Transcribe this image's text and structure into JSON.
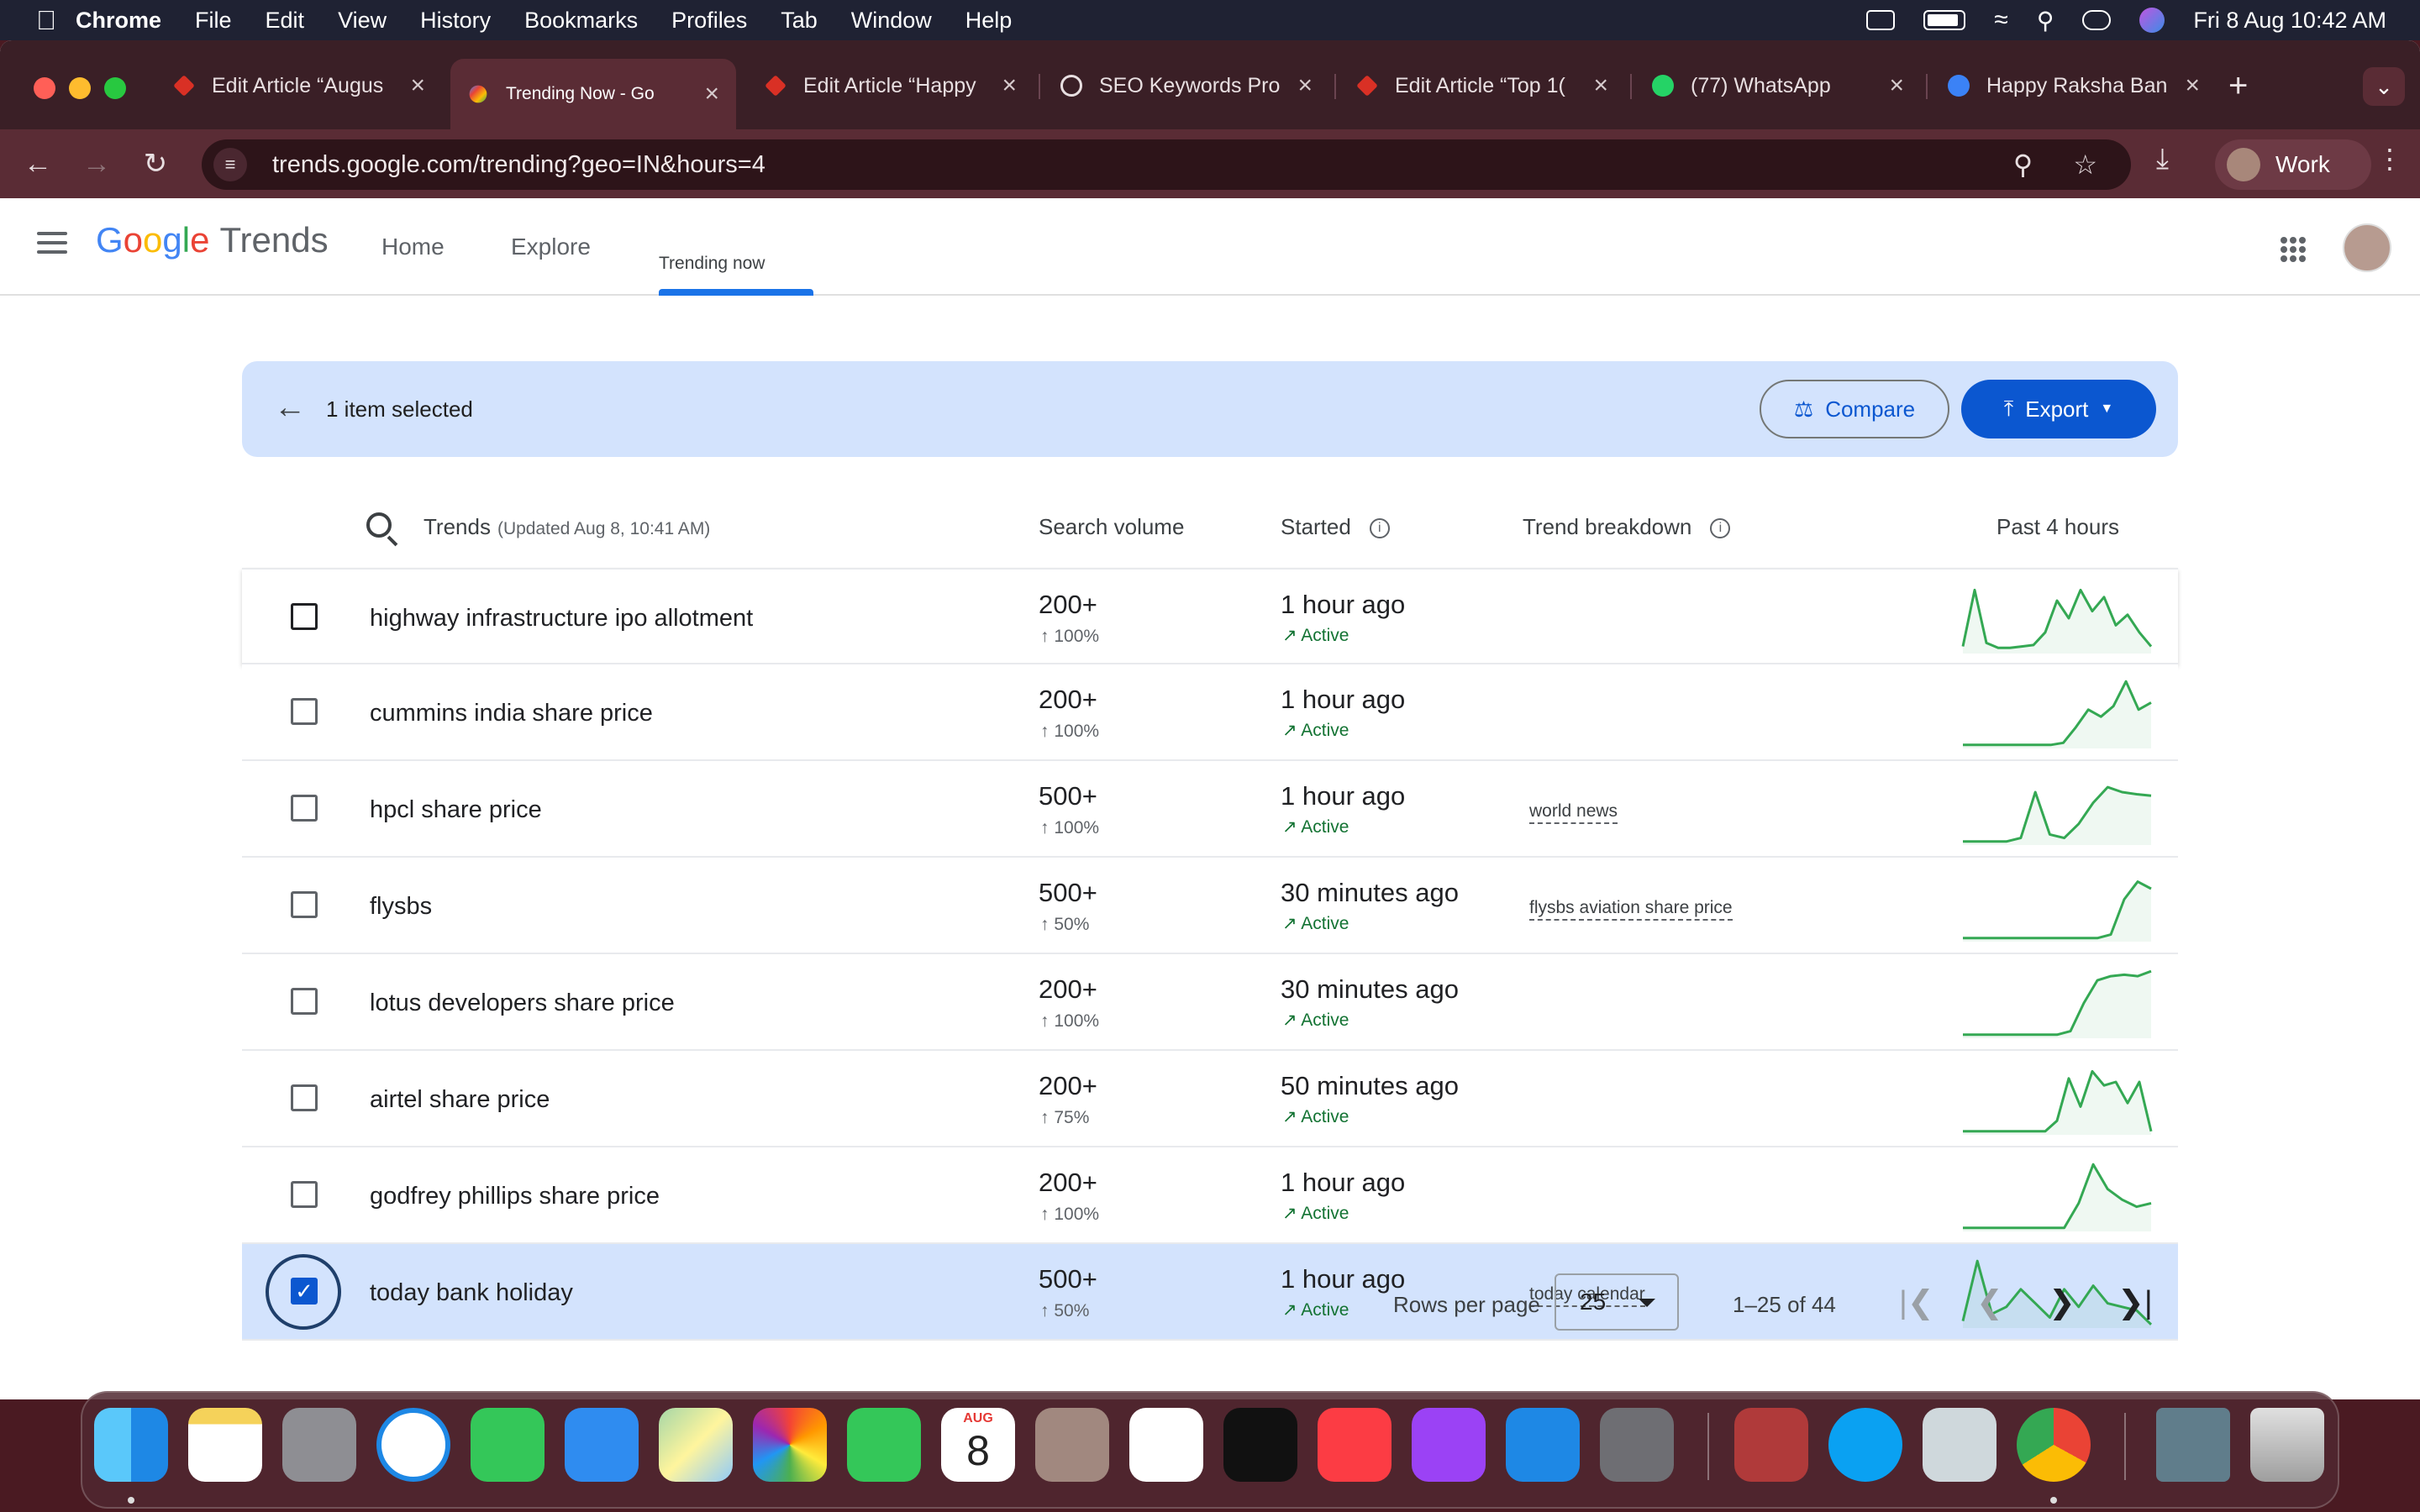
{
  "menubar": {
    "app": "Chrome",
    "items": [
      "File",
      "Edit",
      "View",
      "History",
      "Bookmarks",
      "Profiles",
      "Tab",
      "Window",
      "Help"
    ],
    "datetime": "Fri 8 Aug  10:42 AM"
  },
  "tabs": [
    {
      "title": "Edit Article “Augus",
      "favicon_color": "#d93025",
      "active": false
    },
    {
      "title": "Trending Now - Go",
      "favicon_color": "#4285f4",
      "active": true
    },
    {
      "title": "Edit Article “Happy",
      "favicon_color": "#d93025",
      "active": false
    },
    {
      "title": "SEO Keywords Pro",
      "favicon_color": "#e8dfe1",
      "active": false
    },
    {
      "title": "Edit Article “Top 1(",
      "favicon_color": "#d93025",
      "active": false
    },
    {
      "title": "(77) WhatsApp",
      "favicon_color": "#25d366",
      "active": false
    },
    {
      "title": "Happy Raksha Ban",
      "favicon_color": "#3b82f6",
      "active": false
    }
  ],
  "toolbar": {
    "url": "trends.google.com/trending?geo=IN&hours=4",
    "profile_label": "Work"
  },
  "gt": {
    "logo_google": [
      "G",
      "o",
      "o",
      "g",
      "l",
      "e"
    ],
    "logo_trends": "Trends",
    "nav": {
      "home": "Home",
      "explore": "Explore",
      "trending": "Trending now"
    }
  },
  "selection": {
    "text": "1 item selected",
    "compare_label": "Compare",
    "export_label": "Export"
  },
  "table": {
    "headers": {
      "trends": "Trends",
      "updated": "(Updated Aug 8, 10:41 AM)",
      "volume": "Search volume",
      "started": "Started",
      "breakdown": "Trend breakdown",
      "past": "Past 4 hours"
    },
    "rows": [
      {
        "name": "highway infrastructure ipo allotment",
        "volume": "200+",
        "pct": "↑ 100%",
        "started": "1 hour ago",
        "status": "Active",
        "breakdown": "",
        "checked": false,
        "spark": [
          0.1,
          0.9,
          0.15,
          0.08,
          0.08,
          0.1,
          0.12,
          0.3,
          0.75,
          0.5,
          0.9,
          0.6,
          0.8,
          0.4,
          0.55,
          0.3,
          0.1
        ]
      },
      {
        "name": "cummins india share price",
        "volume": "200+",
        "pct": "↑ 100%",
        "started": "1 hour ago",
        "status": "Active",
        "breakdown": "",
        "checked": false,
        "spark": [
          0.05,
          0.05,
          0.05,
          0.05,
          0.05,
          0.05,
          0.05,
          0.05,
          0.08,
          0.3,
          0.55,
          0.45,
          0.6,
          0.95,
          0.55,
          0.65
        ]
      },
      {
        "name": "hpcl share price",
        "volume": "500+",
        "pct": "↑ 100%",
        "started": "1 hour ago",
        "status": "Active",
        "breakdown": "world news",
        "checked": false,
        "spark": [
          0.05,
          0.05,
          0.05,
          0.05,
          0.1,
          0.75,
          0.15,
          0.1,
          0.3,
          0.6,
          0.82,
          0.75,
          0.72,
          0.7
        ]
      },
      {
        "name": "flysbs",
        "volume": "500+",
        "pct": "↑ 50%",
        "started": "30 minutes ago",
        "status": "Active",
        "breakdown": "flysbs aviation share price",
        "checked": false,
        "spark": [
          0.05,
          0.05,
          0.05,
          0.05,
          0.05,
          0.05,
          0.05,
          0.05,
          0.05,
          0.05,
          0.05,
          0.1,
          0.6,
          0.85,
          0.75
        ]
      },
      {
        "name": "lotus developers share price",
        "volume": "200+",
        "pct": "↑ 100%",
        "started": "30 minutes ago",
        "status": "Active",
        "breakdown": "",
        "checked": false,
        "spark": [
          0.05,
          0.05,
          0.05,
          0.05,
          0.05,
          0.05,
          0.05,
          0.05,
          0.1,
          0.5,
          0.82,
          0.88,
          0.9,
          0.88,
          0.95
        ]
      },
      {
        "name": "airtel share price",
        "volume": "200+",
        "pct": "↑ 75%",
        "started": "50 minutes ago",
        "status": "Active",
        "breakdown": "",
        "checked": false,
        "spark": [
          0.05,
          0.05,
          0.05,
          0.05,
          0.05,
          0.05,
          0.05,
          0.05,
          0.2,
          0.8,
          0.4,
          0.9,
          0.7,
          0.75,
          0.45,
          0.75,
          0.05
        ]
      },
      {
        "name": "godfrey phillips share price",
        "volume": "200+",
        "pct": "↑ 100%",
        "started": "1 hour ago",
        "status": "Active",
        "breakdown": "",
        "checked": false,
        "spark": [
          0.05,
          0.05,
          0.05,
          0.05,
          0.05,
          0.05,
          0.05,
          0.05,
          0.4,
          0.95,
          0.6,
          0.45,
          0.35,
          0.4
        ]
      },
      {
        "name": "today bank holiday",
        "volume": "500+",
        "pct": "↑ 50%",
        "started": "1 hour ago",
        "status": "Active",
        "breakdown": "today calendar",
        "checked": true,
        "spark": [
          0.1,
          0.95,
          0.2,
          0.3,
          0.55,
          0.35,
          0.15,
          0.55,
          0.3,
          0.6,
          0.35,
          0.3,
          0.25,
          0.05
        ]
      }
    ]
  },
  "pagination": {
    "rows_per_page_label": "Rows per page",
    "rows_per_page_value": "25",
    "range": "1–25 of 44"
  },
  "colors": {
    "spark_line": "#34a853",
    "accent": "#0b57d0"
  },
  "dock": {
    "calendar_month": "AUG",
    "calendar_day": "8",
    "apps": [
      "finder-icon",
      "notes-icon",
      "launchpad-icon",
      "safari-icon",
      "messages-icon",
      "mail-icon",
      "maps-icon",
      "photos-icon",
      "facetime-icon",
      "calendar-icon",
      "contacts-icon",
      "reminders-icon",
      "appletv-icon",
      "music-icon",
      "podcasts-icon",
      "appstore-icon",
      "system-settings-icon",
      "dictionary-icon",
      "skype-icon",
      "preview-icon",
      "chrome-icon",
      "downloads-stack-icon",
      "trash-icon"
    ]
  }
}
